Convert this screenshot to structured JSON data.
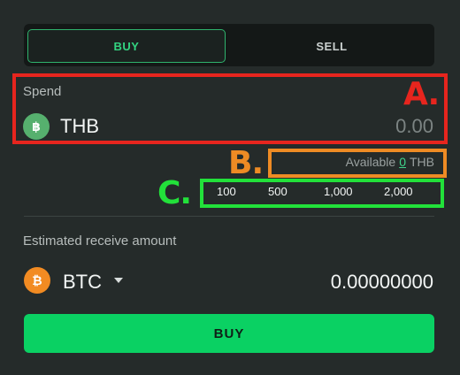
{
  "toggle": {
    "buy_label": "BUY",
    "sell_label": "SELL"
  },
  "spend": {
    "label": "Spend",
    "currency": "THB",
    "amount_placeholder": "0.00",
    "currency_icon": "baht-coin-icon"
  },
  "available": {
    "prefix": "Available",
    "value": "0",
    "unit": "THB"
  },
  "quick_amounts": [
    "100",
    "500",
    "1,000",
    "2,000"
  ],
  "receive": {
    "label": "Estimated receive amount",
    "currency": "BTC",
    "amount": "0.00000000",
    "currency_icon": "bitcoin-icon"
  },
  "submit": {
    "label": "BUY"
  },
  "annotations": {
    "a": "A.",
    "b": "B.",
    "c": "C."
  },
  "colors": {
    "background": "#252b2a",
    "accent_green": "#0ad163",
    "annotation_red": "#e7251e",
    "annotation_orange": "#ee8b24",
    "annotation_green": "#22e13a"
  }
}
